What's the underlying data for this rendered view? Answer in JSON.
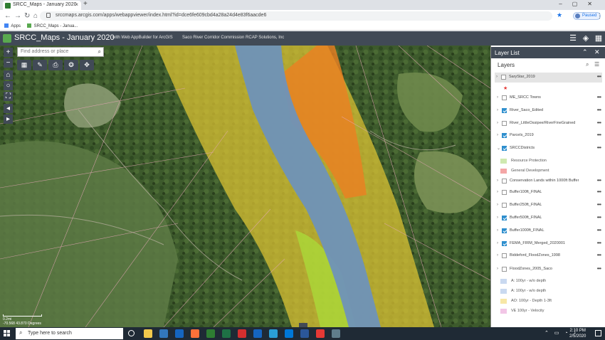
{
  "browser": {
    "tab_title": "SRCC_Maps - January 2020",
    "tab_close": "×",
    "new_tab": "+",
    "url": "srccmaps.arcgis.com/apps/webappviewer/index.html?id=dce6fe609cbd4a28a24d4e83f6aacde6",
    "profile_label": "Paused",
    "bookmarks": [
      {
        "label": "Apps",
        "color": "#4285f4"
      },
      {
        "label": "SRCC_Maps - Janua...",
        "color": "#59a94f"
      }
    ]
  },
  "app": {
    "title": "SRCC_Maps - January 2020",
    "subtitle": "with Web AppBuilder for ArcGIS",
    "organization": "Saco River Corridor Commission   RCAP Solutions, Inc",
    "search_placeholder": "Find address or place"
  },
  "map": {
    "scale_label": "0.2mi",
    "coords_label": "-70.568 43.870 Degrees",
    "colors": {
      "river": "#6f92b8",
      "yellow_buffer": "#e0d23a",
      "orange_zone": "#ee8a2a",
      "green_zone": "#b8e04a",
      "parcel_lines": "#e8a7b9"
    }
  },
  "layer_panel": {
    "title": "Layer List",
    "layers_label": "Layers",
    "layers": [
      {
        "name": "SaryStar_2019",
        "checked": false,
        "selected": true
      },
      {
        "name": "ME_SRCC Towns",
        "checked": false
      },
      {
        "name": "River_Saco_Edited",
        "checked": true
      },
      {
        "name": "River_LittleOssipee/RiverFineGrained",
        "checked": false
      },
      {
        "name": "Parcels_2019",
        "checked": true
      },
      {
        "name": "SRCCDistricts",
        "checked": true
      },
      {
        "name": "Conservation Lands within 1000ft Buffer",
        "checked": false
      },
      {
        "name": "Buffer100ft_FINAL",
        "checked": false
      },
      {
        "name": "Buffer250ft_FINAL",
        "checked": false
      },
      {
        "name": "Buffer500ft_FINAL",
        "checked": true
      },
      {
        "name": "Buffer1000ft_FINAL",
        "checked": true
      },
      {
        "name": "FEMA_FIRM_Merged_2020001",
        "checked": true
      },
      {
        "name": "Biddeford_FloodZones_1998",
        "checked": false
      },
      {
        "name": "FloodZones_2005_Saco",
        "checked": false
      }
    ],
    "district_legend": [
      {
        "label": "Resource Protection",
        "color": "#cfe9b0"
      },
      {
        "label": "General Development",
        "color": "#f4a6a6"
      }
    ],
    "flood_legend": [
      {
        "label": "A: 100yr - w/o depth",
        "color": "#c9d9f0"
      },
      {
        "label": "A: 100yr - w/o depth",
        "color": "#c9d9f0"
      },
      {
        "label": "AO: 100yr - Depth 1-3ft",
        "color": "#f7e7a6"
      },
      {
        "label": "VE 100yr - Velocity",
        "color": "#f2c6e6"
      }
    ]
  },
  "taskbar": {
    "search_placeholder": "Type here to search",
    "time": "2:10 PM",
    "date": "2/5/2020",
    "apps": [
      {
        "name": "task-view-icon",
        "color": "#1f2a35"
      },
      {
        "name": "file-explorer-icon",
        "color": "#f2c94c"
      },
      {
        "name": "edge-icon",
        "color": "#3277bc"
      },
      {
        "name": "outlook-icon",
        "color": "#1565c0"
      },
      {
        "name": "firefox-icon",
        "color": "#ff7139"
      },
      {
        "name": "chrome-dev-icon",
        "color": "#2e7d32"
      },
      {
        "name": "excel-icon",
        "color": "#1e7145"
      },
      {
        "name": "acrobat-icon",
        "color": "#d32f2f"
      },
      {
        "name": "powerpoint-icon",
        "color": "#1565c0"
      },
      {
        "name": "store-icon",
        "color": "#2a9fd6"
      },
      {
        "name": "mail-icon",
        "color": "#0078d7"
      },
      {
        "name": "word-icon",
        "color": "#2b579a"
      },
      {
        "name": "chrome-icon",
        "color": "#e53935"
      },
      {
        "name": "snip-icon",
        "color": "#607d8b"
      }
    ]
  }
}
